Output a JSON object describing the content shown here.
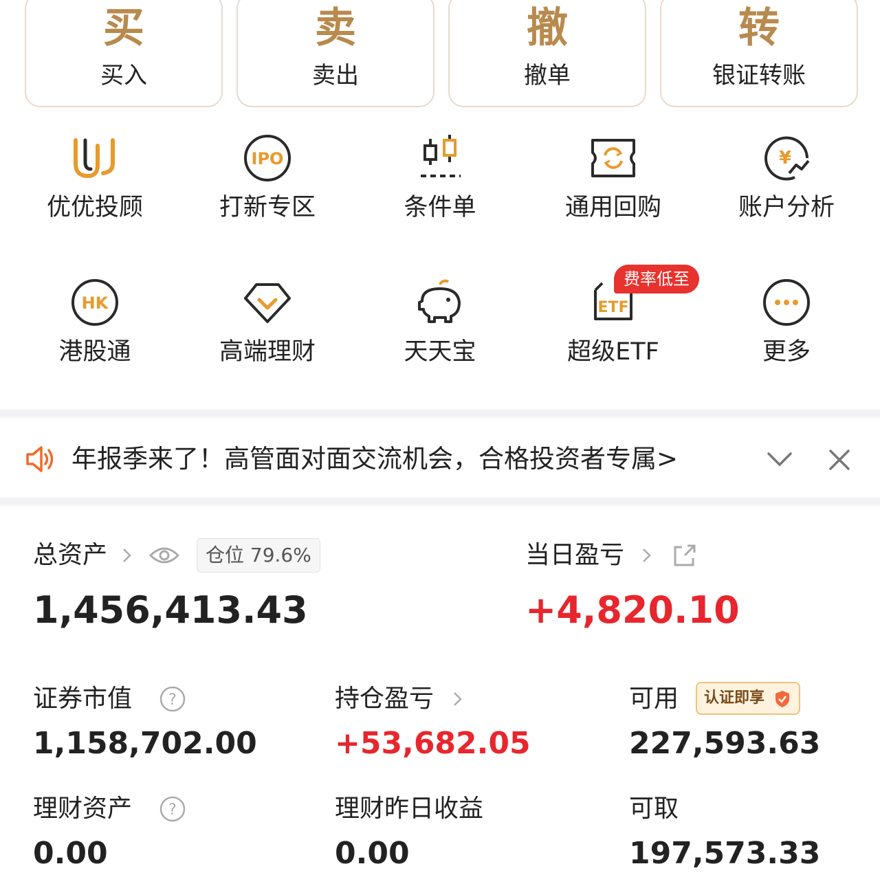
{
  "trade": [
    {
      "glyph": "买",
      "label": "买入"
    },
    {
      "glyph": "卖",
      "label": "卖出"
    },
    {
      "glyph": "撤",
      "label": "撤单"
    },
    {
      "glyph": "转",
      "label": "银证转账"
    }
  ],
  "grid": [
    {
      "icon": "youyou-advisor-icon",
      "label": "优优投顾"
    },
    {
      "icon": "ipo-icon",
      "label": "打新专区",
      "icon_text": "IPO"
    },
    {
      "icon": "candlestick-icon",
      "label": "条件单"
    },
    {
      "icon": "repurchase-icon",
      "label": "通用回购"
    },
    {
      "icon": "yen-analysis-icon",
      "label": "账户分析",
      "icon_text": "¥"
    },
    {
      "icon": "hk-icon",
      "label": "港股通",
      "icon_text": "HK"
    },
    {
      "icon": "diamond-icon",
      "label": "高端理财"
    },
    {
      "icon": "piggy-bank-icon",
      "label": "天天宝"
    },
    {
      "icon": "etf-basket-icon",
      "label": "超级ETF",
      "icon_text": "ETF"
    },
    {
      "icon": "more-dots-icon",
      "label": "更多"
    }
  ],
  "etf_badge": "费率低至",
  "notice": {
    "text": "年报季来了！高管面对面交流机会，合格投资者专属>"
  },
  "assets": {
    "total_label": "总资产",
    "position_badge": "仓位 79.6%",
    "total_value": "1,456,413.43",
    "daily_pl_label": "当日盈亏",
    "daily_pl_value": "+4,820.10",
    "securities_label": "证券市值",
    "securities_value": "1,158,702.00",
    "holding_pl_label": "持仓盈亏",
    "holding_pl_value": "+53,682.05",
    "available_label": "可用",
    "cert_badge": "认证即享",
    "available_value": "227,593.63",
    "wealth_label": "理财资产",
    "wealth_value": "0.00",
    "wealth_yesterday_label": "理财昨日收益",
    "wealth_yesterday_value": "0.00",
    "withdrawable_label": "可取",
    "withdrawable_value": "197,573.33"
  },
  "colors": {
    "gold": "#b88a4e",
    "icon_orange": "#e89a2c",
    "red": "#e8262d",
    "badge_red": "#e8322d"
  }
}
